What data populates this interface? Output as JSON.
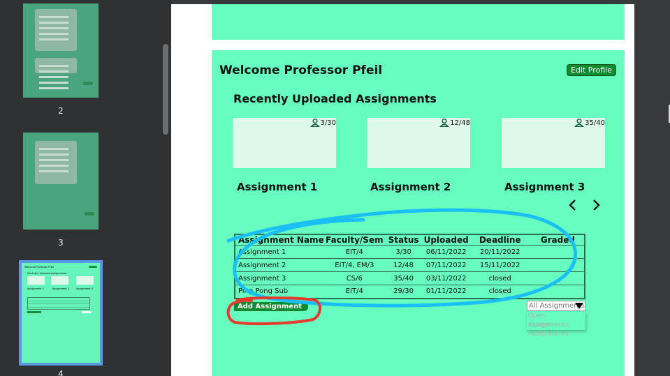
{
  "sidebar": {
    "pages": [
      {
        "number": "2"
      },
      {
        "number": "3"
      },
      {
        "number": "4"
      }
    ],
    "mini": {
      "title": "Welcome Professor Pfeil",
      "subtitle": "Recently Uploaded Assignments",
      "labels": [
        "Assignment 1",
        "Assignment 2",
        "Assignment 3"
      ]
    }
  },
  "header": {
    "welcome": "Welcome Professor Pfeil",
    "edit_profile": "Edit Profile"
  },
  "recent": {
    "title": "Recently Uploaded Assignments",
    "cards": [
      {
        "count": "3/30",
        "title": "Assignment 1"
      },
      {
        "count": "12/48",
        "title": "Assignment 2"
      },
      {
        "count": "35/40",
        "title": "Assignment 3"
      }
    ]
  },
  "table": {
    "headers": [
      "Assignment Name",
      "Faculty/Sem",
      "Status",
      "Uploaded",
      "Deadline",
      "Graded"
    ],
    "rows": [
      [
        "Assignment 1",
        "EIT/4",
        "3/30",
        "06/11/2022",
        "20/11/2022",
        ""
      ],
      [
        "Assignment 2",
        "EIT/4, EM/3",
        "12/48",
        "07/11/2022",
        "15/11/2022",
        ""
      ],
      [
        "Assignment 3",
        "CS/6",
        "35/40",
        "03/11/2022",
        "closed",
        ""
      ],
      [
        "Ping Pong Sub",
        "EIT/4",
        "29/30",
        "01/11/2022",
        "closed",
        ""
      ]
    ]
  },
  "actions": {
    "add_assignment": "Add Assignment"
  },
  "filter": {
    "selected": "All Assignments",
    "options": [
      "Open Assignments",
      "Closed Assignments"
    ]
  },
  "colors": {
    "page_bg": "#67fdbf",
    "button": "#108a2e",
    "annotation_blue": "#19bff5",
    "annotation_red": "#e53b2f"
  }
}
